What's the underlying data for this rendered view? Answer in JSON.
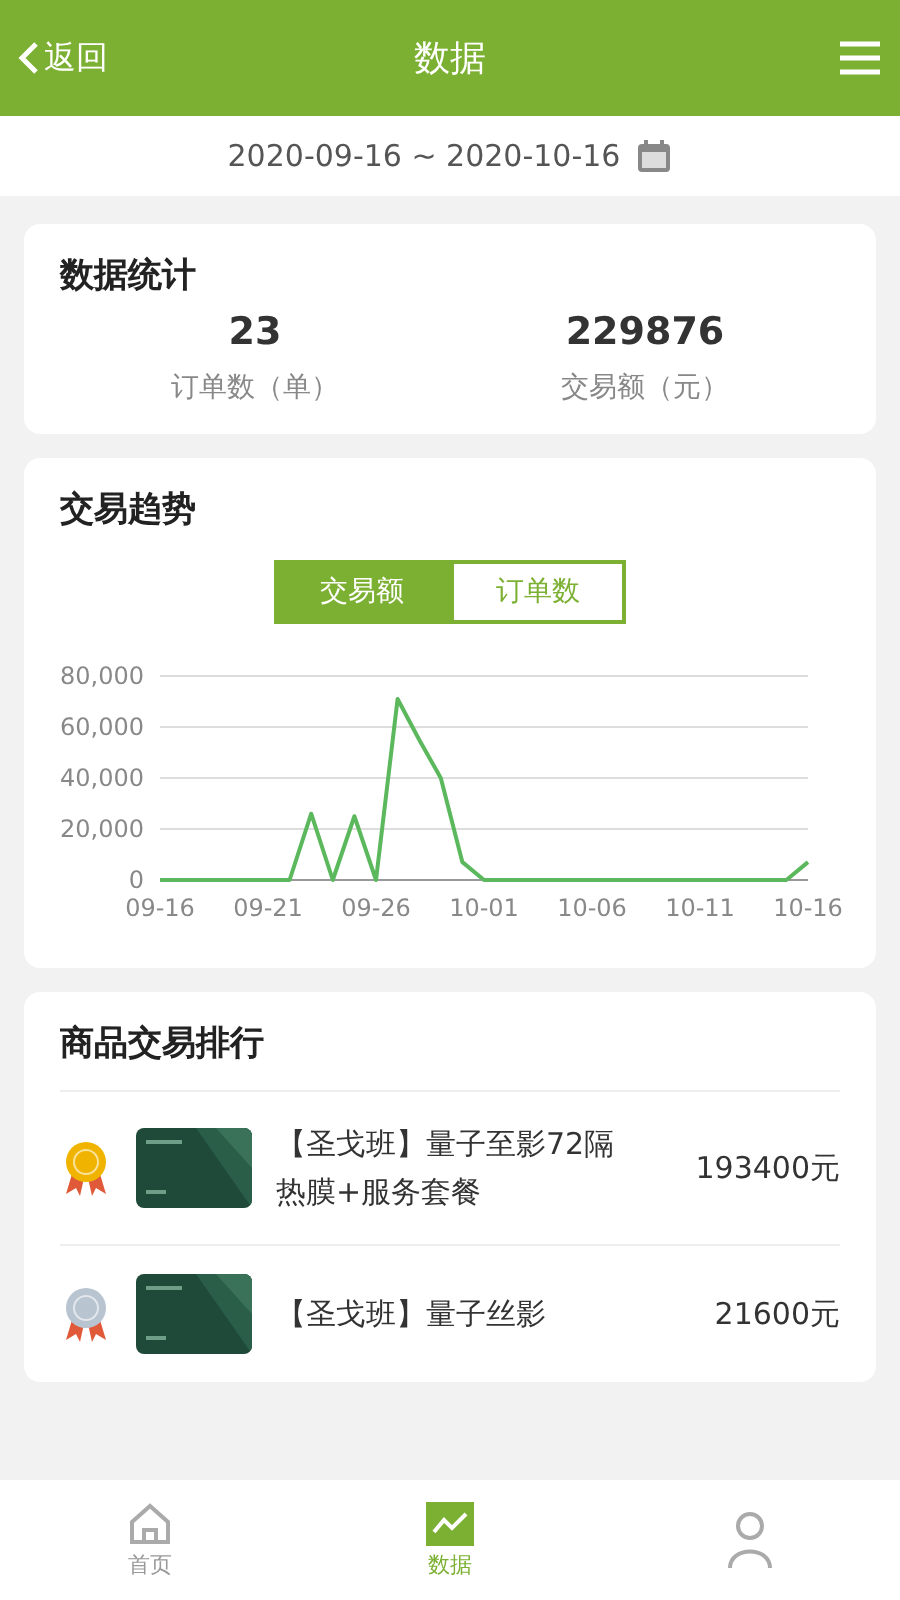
{
  "header": {
    "back": "返回",
    "title": "数据"
  },
  "date_range": "2020-09-16 ~ 2020-10-16",
  "stats": {
    "title": "数据统计",
    "items": [
      {
        "value": "23",
        "label": "订单数（单）"
      },
      {
        "value": "229876",
        "label": "交易额（元）"
      }
    ]
  },
  "trend": {
    "title": "交易趋势",
    "tabs": [
      {
        "label": "交易额",
        "selected": true
      },
      {
        "label": "订单数",
        "selected": false
      }
    ],
    "chart_data": {
      "type": "line",
      "grid": true,
      "categories": [
        "09-16",
        null,
        null,
        null,
        null,
        "09-21",
        null,
        null,
        null,
        null,
        "09-26",
        null,
        null,
        null,
        null,
        "10-01",
        null,
        null,
        null,
        null,
        "10-06",
        null,
        null,
        null,
        null,
        "10-11",
        null,
        null,
        null,
        null,
        "10-16"
      ],
      "series": [
        {
          "color": "#5cb85c",
          "values": [
            0,
            0,
            0,
            0,
            0,
            0,
            0,
            26000,
            0,
            25000,
            0,
            71000,
            55000,
            40000,
            7000,
            0,
            0,
            0,
            0,
            0,
            0,
            0,
            0,
            0,
            0,
            0,
            0,
            0,
            0,
            0,
            7000
          ]
        }
      ],
      "ylim": [
        0,
        80000
      ],
      "yticks": [
        {
          "value": 0,
          "label": "0"
        },
        {
          "value": 20000,
          "label": "20,000"
        },
        {
          "value": 40000,
          "label": "40,000"
        },
        {
          "value": 60000,
          "label": "60,000"
        },
        {
          "value": 80000,
          "label": "80,000"
        }
      ]
    }
  },
  "ranking": {
    "title": "商品交易排行",
    "items": [
      {
        "kind": "gold",
        "name": "【圣戈班】量子至影72隔热膜+服务套餐",
        "amount": "193400元"
      },
      {
        "kind": "silver",
        "name": "【圣戈班】量子丝影",
        "amount": "21600元"
      }
    ]
  },
  "tabbar": [
    {
      "kind": "home",
      "label": "首页",
      "selected": false
    },
    {
      "kind": "chart",
      "label": "数据",
      "selected": true
    },
    {
      "kind": "person",
      "selected": false
    }
  ]
}
